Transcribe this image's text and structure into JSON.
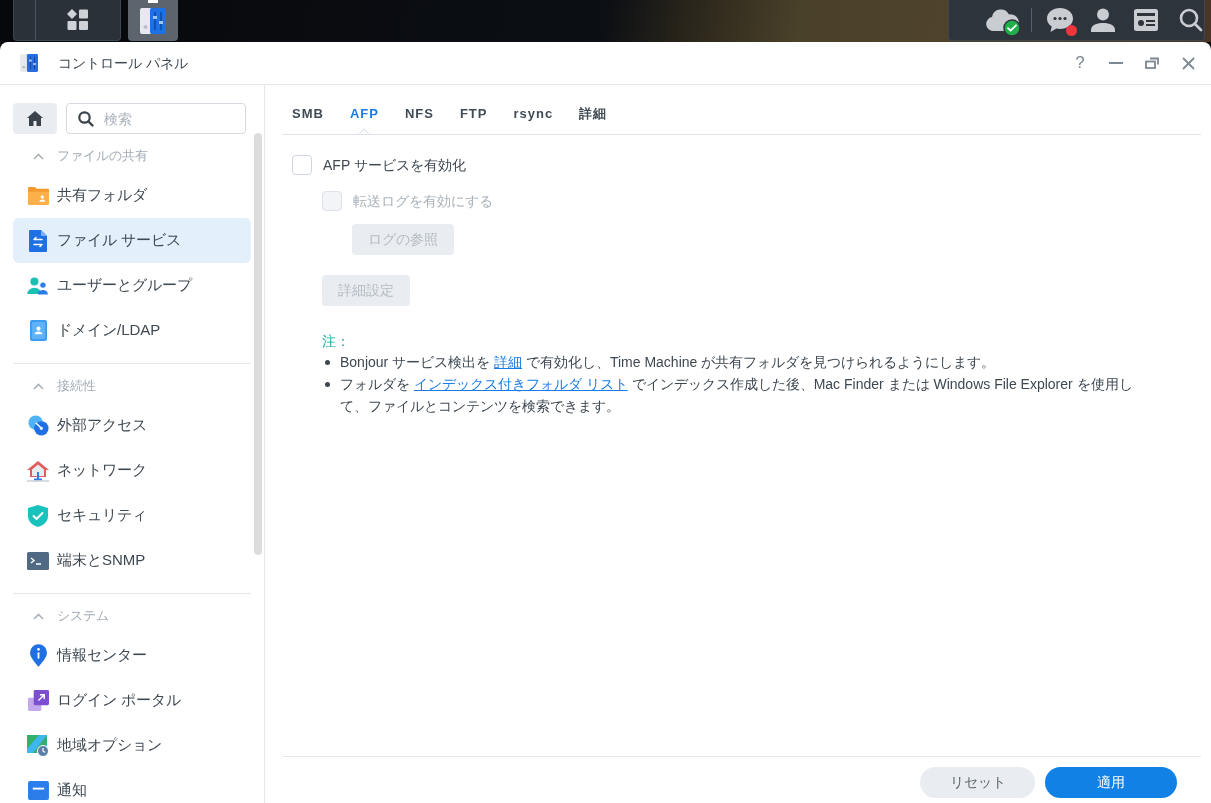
{
  "taskbar": {
    "apps": [
      {
        "kind": "main-menu",
        "selected": false
      },
      {
        "kind": "control-panel",
        "selected": true
      }
    ],
    "tray": [
      {
        "kind": "cloud",
        "synced": true
      },
      {
        "kind": "messages",
        "unread": true
      },
      {
        "kind": "account"
      },
      {
        "kind": "widgets"
      },
      {
        "kind": "search"
      }
    ]
  },
  "window": {
    "title": "コントロール パネル",
    "help": "?"
  },
  "sidebar": {
    "search": {
      "placeholder": "検索"
    },
    "sections": [
      {
        "title": "ファイルの共有",
        "expanded": true,
        "items": [
          {
            "kind": "shared-folder",
            "label": "共有フォルダ",
            "selected": false
          },
          {
            "kind": "file-services",
            "label": "ファイル サービス",
            "selected": true
          },
          {
            "kind": "users",
            "label": "ユーザーとグループ",
            "selected": false
          },
          {
            "kind": "domain",
            "label": "ドメイン/LDAP",
            "selected": false
          }
        ]
      },
      {
        "title": "接続性",
        "expanded": true,
        "items": [
          {
            "kind": "external-access",
            "label": "外部アクセス",
            "selected": false
          },
          {
            "kind": "network",
            "label": "ネットワーク",
            "selected": false
          },
          {
            "kind": "security",
            "label": "セキュリティ",
            "selected": false
          },
          {
            "kind": "terminal",
            "label": "端末とSNMP",
            "selected": false
          }
        ]
      },
      {
        "title": "システム",
        "expanded": true,
        "items": [
          {
            "kind": "info-center",
            "label": "情報センター",
            "selected": false
          },
          {
            "kind": "login-portal",
            "label": "ログイン ポータル",
            "selected": false
          },
          {
            "kind": "regional",
            "label": "地域オプション",
            "selected": false
          },
          {
            "kind": "notification",
            "label": "通知",
            "selected": false
          }
        ]
      }
    ]
  },
  "tabs": [
    {
      "label": "SMB",
      "selected": false
    },
    {
      "label": "AFP",
      "selected": true
    },
    {
      "label": "NFS",
      "selected": false
    },
    {
      "label": "FTP",
      "selected": false
    },
    {
      "label": "rsync",
      "selected": false
    },
    {
      "label": "詳細",
      "selected": false
    }
  ],
  "settings": [
    {
      "kind": "checkbox",
      "label": "AFP サービスを有効化",
      "checked": false,
      "disabled": false,
      "children": [
        {
          "kind": "checkbox",
          "label": "転送ログを有効にする",
          "checked": false,
          "disabled": true,
          "children": [
            {
              "kind": "button",
              "label": "ログの参照",
              "disabled": true
            }
          ]
        },
        {
          "kind": "button",
          "label": "詳細設定",
          "disabled": true
        }
      ]
    }
  ],
  "note": {
    "title": "注：",
    "bullets": [
      {
        "parts": [
          {
            "kind": "text",
            "text": "Bonjour サービス検出を "
          },
          {
            "kind": "link",
            "text": "詳細"
          },
          {
            "kind": "text",
            "text": " で有効化し、Time Machine が共有フォルダを見つけられるようにします。"
          }
        ]
      },
      {
        "parts": [
          {
            "kind": "text",
            "text": "フォルダを "
          },
          {
            "kind": "link",
            "text": "インデックス付きフォルダ リスト"
          },
          {
            "kind": "text",
            "text": " でインデックス作成した後、Mac Finder または Windows File Explorer を使用して、ファイルとコンテンツを検索できます。"
          }
        ]
      }
    ]
  },
  "footer": {
    "buttons": [
      {
        "kind": "secondary",
        "label": "リセット"
      },
      {
        "kind": "primary",
        "label": "適用"
      }
    ]
  }
}
